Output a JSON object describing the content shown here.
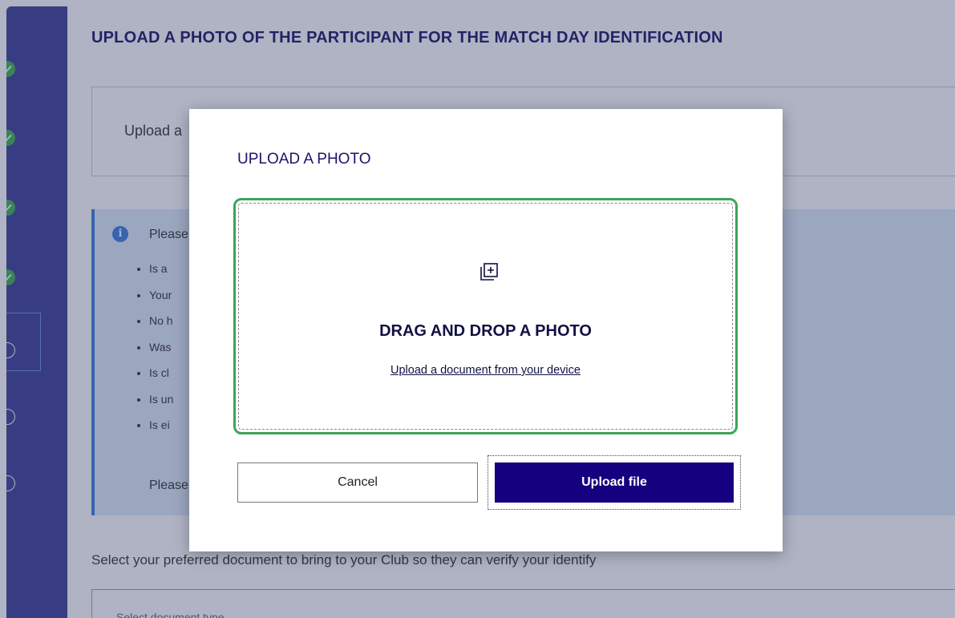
{
  "colors": {
    "sidebar": "#3d3f97",
    "step_done": "#3fb34f",
    "info_background": "#dfeaf8",
    "info_accent": "#3b7de0",
    "dropzone_border": "#3fa35a",
    "primary_button": "#15017f",
    "heading": "#1a1468"
  },
  "stepper": {
    "steps": [
      {
        "status": "complete",
        "icon": "check-icon"
      },
      {
        "status": "complete",
        "icon": "check-icon"
      },
      {
        "status": "complete",
        "icon": "check-icon"
      },
      {
        "status": "complete",
        "icon": "check-icon"
      },
      {
        "status": "current",
        "icon": "circle-icon"
      },
      {
        "status": "pending",
        "icon": "circle-icon"
      },
      {
        "status": "pending",
        "icon": "circle-icon"
      }
    ]
  },
  "page": {
    "title": "UPLOAD A PHOTO OF THE PARTICIPANT FOR THE MATCH DAY IDENTIFICATION",
    "upload_box_label": "Upload a",
    "info": {
      "icon": "info-icon",
      "lead": "Please",
      "bullets": [
        "Is a",
        "Your",
        "No h",
        "Was",
        "Is cl",
        "Is un",
        "Is ei"
      ],
      "closing": "Please"
    },
    "select_label": "Select your preferred document to bring to your Club so they can verify your identify",
    "select_placeholder": "Select document type"
  },
  "modal": {
    "title": "UPLOAD A PHOTO",
    "dropzone": {
      "icon": "add-photo-icon",
      "title": "DRAG AND DROP A PHOTO",
      "link": "Upload a document from your device"
    },
    "cancel_label": "Cancel",
    "upload_label": "Upload file"
  }
}
